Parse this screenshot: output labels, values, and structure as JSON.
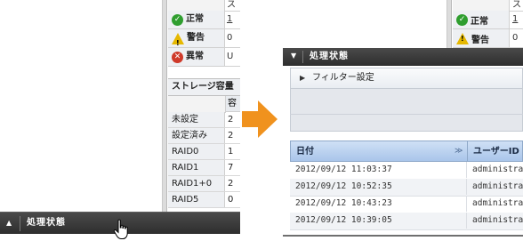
{
  "before": {
    "status_table": {
      "header_partial": "ス",
      "rows": [
        {
          "icon": "check-circle-icon",
          "label": "正常",
          "value": "1"
        },
        {
          "icon": "warning-triangle-icon",
          "label": "警告",
          "value": "0"
        },
        {
          "icon": "error-circle-icon",
          "label": "異常",
          "value": "U"
        }
      ]
    },
    "storage_table": {
      "title": "ストレージ容量",
      "header_partial": "容",
      "rows": [
        {
          "label": "未設定",
          "value": "2"
        },
        {
          "label": "設定済み",
          "value": "2"
        },
        {
          "label": "RAID0",
          "value": "1"
        },
        {
          "label": "RAID1",
          "value": "7"
        },
        {
          "label": "RAID1+0",
          "value": "2"
        },
        {
          "label": "RAID5",
          "value": "0"
        }
      ]
    },
    "panel_bar": {
      "toggle": "▲",
      "title": "処理状態"
    }
  },
  "after": {
    "status_table": {
      "header_partial": "ス",
      "rows": [
        {
          "icon": "check-circle-icon",
          "label": "正常",
          "value": "1"
        },
        {
          "icon": "warning-triangle-icon",
          "label": "警告",
          "value": "0"
        }
      ]
    },
    "panel_bar": {
      "toggle": "▼",
      "title": "処理状態"
    },
    "filter": {
      "toggle": "▶",
      "label": "フィルター設定"
    },
    "grid": {
      "columns": {
        "date": "日付",
        "sort_indicator": "≫",
        "user": "ユーザーID"
      },
      "rows": [
        {
          "date": "2012/09/12 11:03:37",
          "user": "administrator"
        },
        {
          "date": "2012/09/12 10:52:35",
          "user": "administrator"
        },
        {
          "date": "2012/09/12 10:43:23",
          "user": "administrator"
        },
        {
          "date": "2012/09/12 10:39:05",
          "user": "administrator"
        }
      ]
    }
  },
  "colors": {
    "arrow": "#f0921e",
    "bar": "#3a3a3a",
    "grid_header": "#b9d0ee"
  }
}
